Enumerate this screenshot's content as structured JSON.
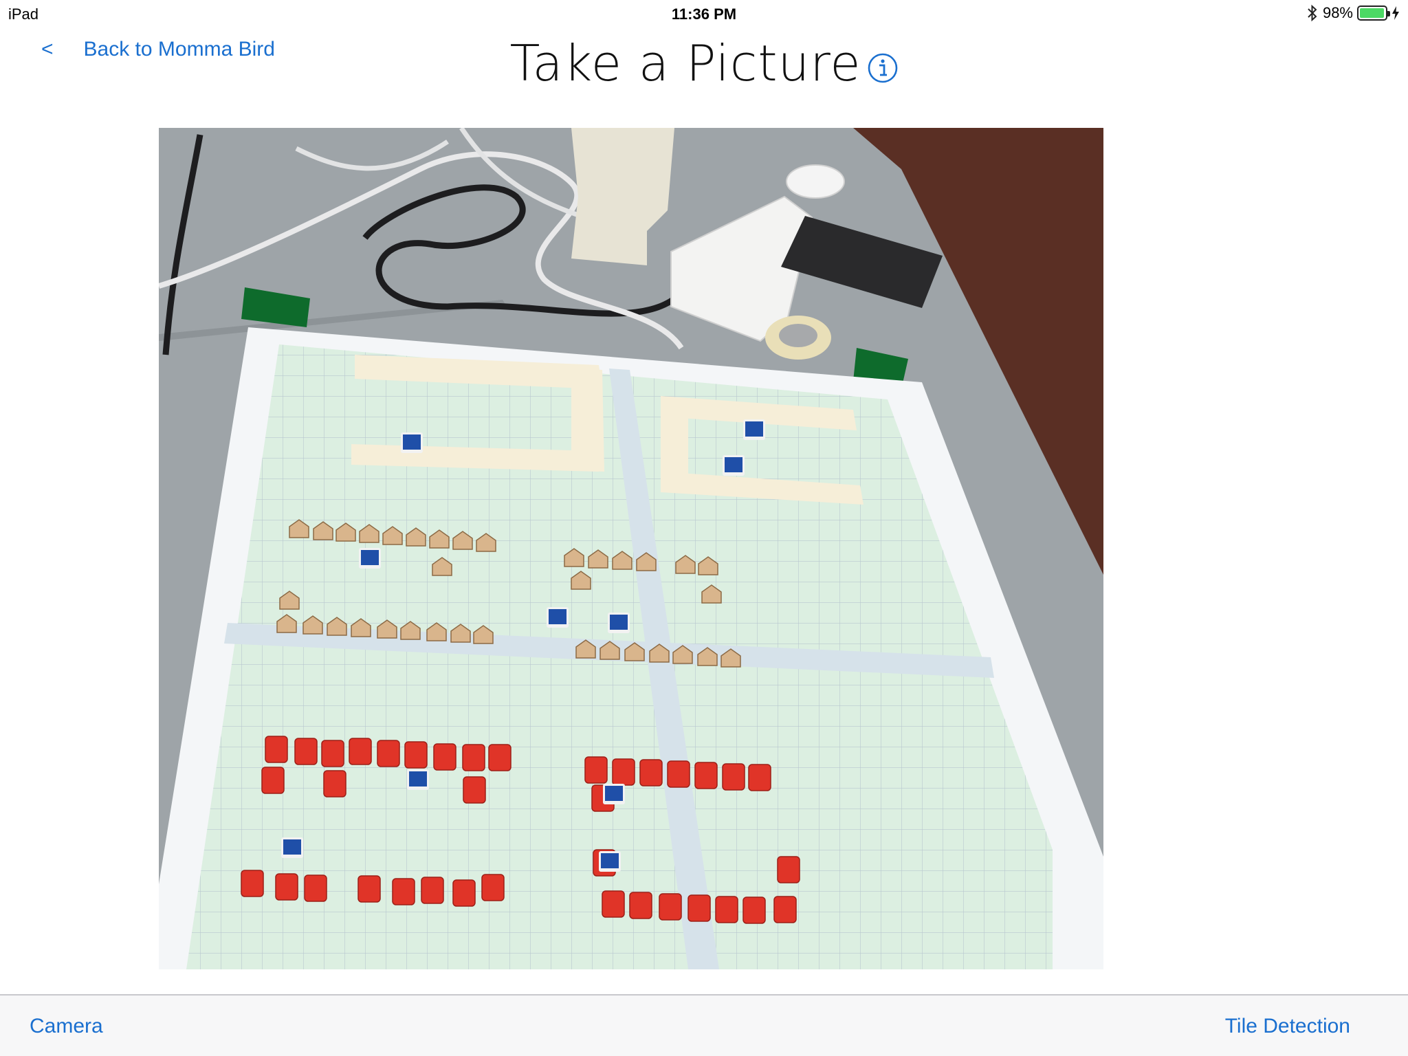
{
  "status_bar": {
    "device": "iPad",
    "time": "11:36 PM",
    "battery_text": "98%",
    "battery_level": 0.98,
    "battery_color": "#4cd964",
    "icons": [
      "bluetooth-icon",
      "battery-icon",
      "charging-bolt-icon"
    ]
  },
  "nav": {
    "back_chevron": "<",
    "back_label": "Back to Momma Bird",
    "title": "Take a Picture",
    "info_icon": "info-circle-icon",
    "tint_color": "#1a6fcf"
  },
  "photo": {
    "subject": "photo"
  },
  "toolbar": {
    "camera_label": "Camera",
    "tile_detection_label": "Tile Detection"
  }
}
